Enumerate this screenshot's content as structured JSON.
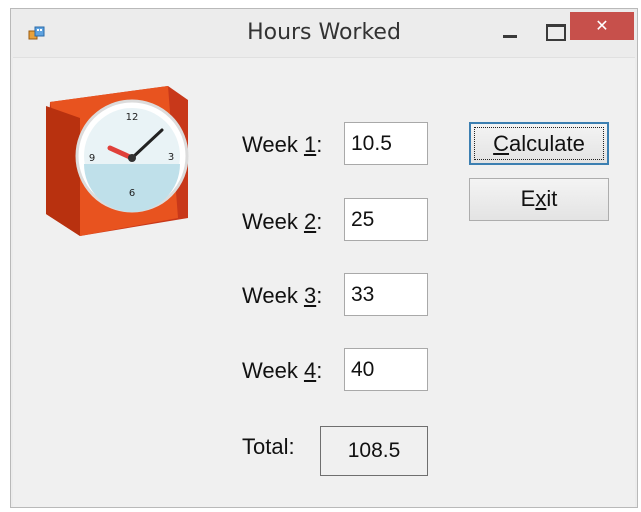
{
  "window": {
    "title": "Hours Worked",
    "close_glyph": "✕",
    "app_icon": "form-app-icon"
  },
  "image": {
    "icon": "alarm-clock-icon"
  },
  "weeks": [
    {
      "prefix": "Week ",
      "mnemonic": "1",
      "suffix": ":",
      "value": "10.5"
    },
    {
      "prefix": "Week ",
      "mnemonic": "2",
      "suffix": ":",
      "value": "25"
    },
    {
      "prefix": "Week ",
      "mnemonic": "3",
      "suffix": ":",
      "value": "33"
    },
    {
      "prefix": "Week ",
      "mnemonic": "4",
      "suffix": ":",
      "value": "40"
    }
  ],
  "total": {
    "label": "Total:",
    "value": "108.5"
  },
  "buttons": {
    "calculate": {
      "mnemonic": "C",
      "rest": "alculate"
    },
    "exit": {
      "pre": "E",
      "mnemonic": "x",
      "post": "it"
    }
  },
  "colors": {
    "close": "#c7504b",
    "clock_box": "#e84a1f",
    "focus_border": "#3c7fb1"
  }
}
